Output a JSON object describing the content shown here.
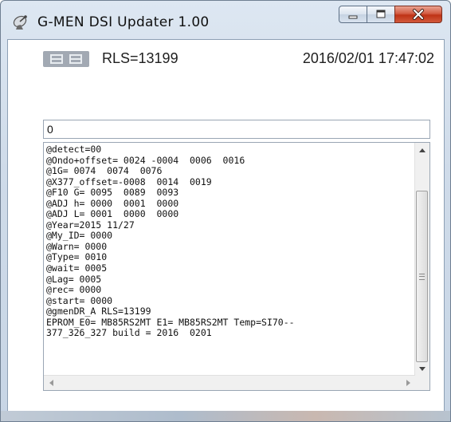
{
  "window": {
    "title": "G-MEN DSI Updater 1.00",
    "icon": "satellite-dish-icon",
    "controls": {
      "minimize_icon": "minimize-icon",
      "maximize_icon": "maximize-icon",
      "close_icon": "close-icon"
    }
  },
  "status": {
    "icon": "device-status-icon",
    "rls": "RLS=13199",
    "datetime": "2016/02/01 17:47:02"
  },
  "input": {
    "value": "0"
  },
  "log": {
    "lines": [
      "@detect=00",
      "@Ondo+offset= 0024 -0004  0006  0016",
      "@1G= 0074  0074  0076",
      "@X377_offset=-0008  0014  0019",
      "@F10 G= 0095  0089  0093",
      "@ADJ h= 0000  0001  0000",
      "@ADJ L= 0001  0000  0000",
      "@Year=2015 11/27",
      "@My_ID= 0000",
      "@Warn= 0000",
      "@Type= 0010",
      "@wait= 0005",
      "@Lag= 0005",
      "@rec= 0000",
      "@start= 0000",
      "@gmenDR_A RLS=13199",
      "EPROM_E0= MB85RS2MT E1= MB85RS2MT Temp=SI70--",
      "377_326_327 build = 2016  0201"
    ]
  },
  "colors": {
    "close_button": "#c8442a",
    "frame": "#cfdbe9"
  }
}
